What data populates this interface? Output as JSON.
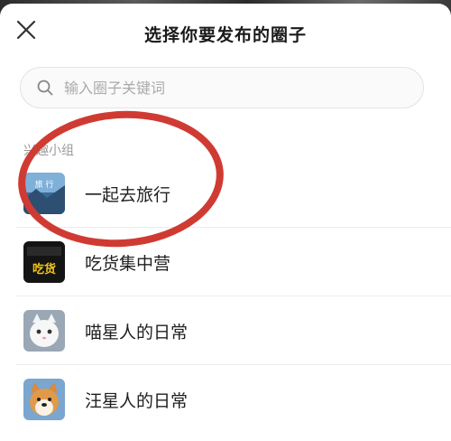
{
  "header": {
    "title": "选择你要发布的圈子",
    "close_icon": "close-icon"
  },
  "search": {
    "placeholder": "输入圈子关键词",
    "icon": "search-icon"
  },
  "section": {
    "label": "兴趣小组"
  },
  "groups": [
    {
      "name": "一起去旅行",
      "avatar_text": "旅 行"
    },
    {
      "name": "吃货集中营",
      "avatar_text": "吃货"
    },
    {
      "name": "喵星人的日常"
    },
    {
      "name": "汪星人的日常"
    }
  ],
  "colors": {
    "annotation": "#cf3b33",
    "background": "#ffffff",
    "text": "#1f1f1f",
    "muted": "#9a9a9a"
  }
}
